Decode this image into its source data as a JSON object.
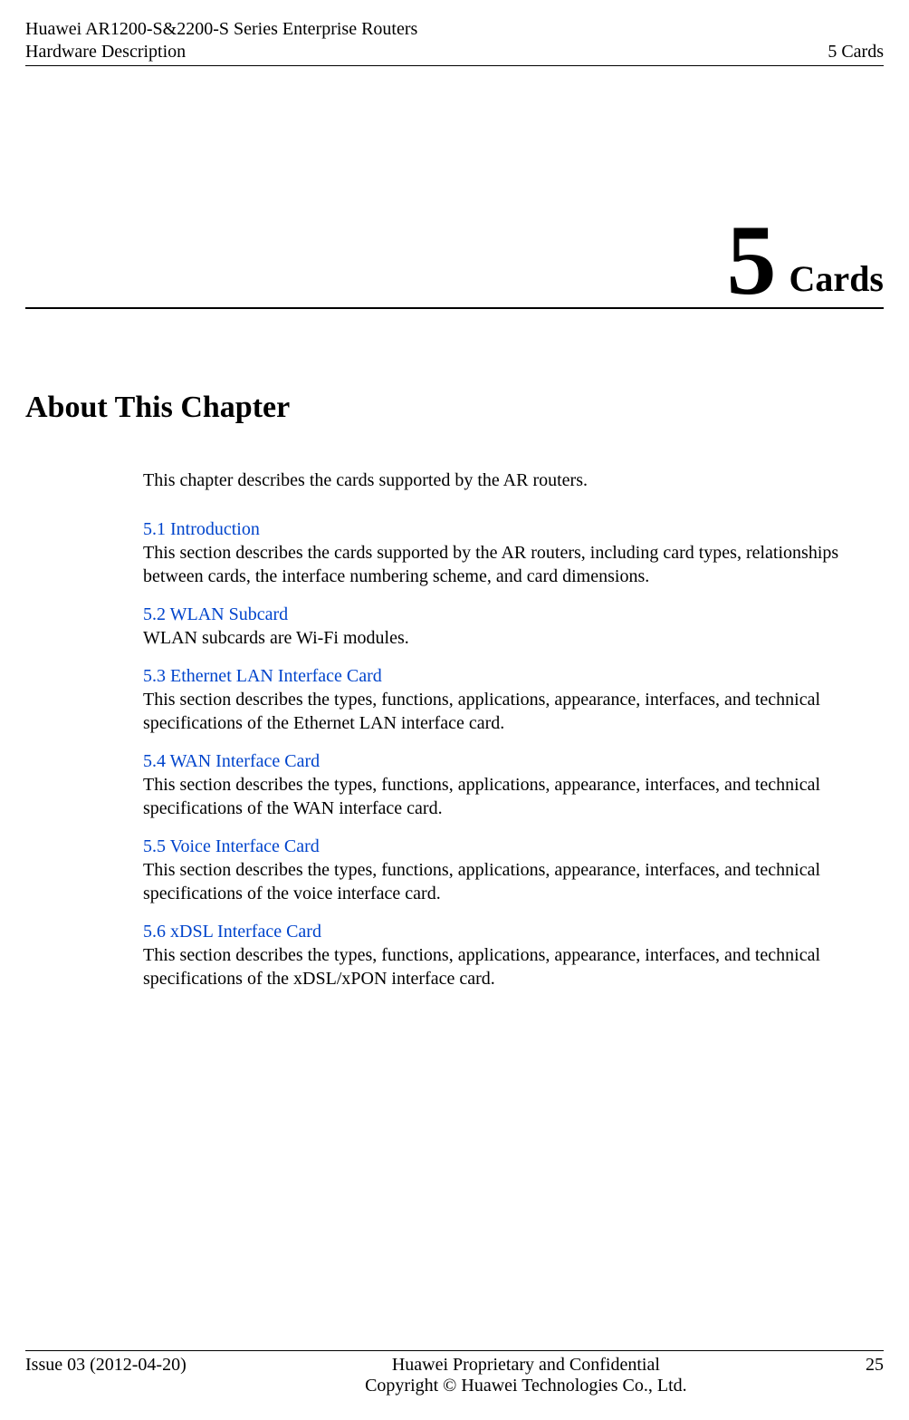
{
  "header": {
    "left_line1": "Huawei AR1200-S&2200-S Series Enterprise Routers",
    "left_line2": "Hardware Description",
    "right": "5 Cards"
  },
  "chapter": {
    "number": "5",
    "name": "Cards"
  },
  "about_heading": "About This Chapter",
  "intro": "This chapter describes the cards supported by the AR routers.",
  "sections": [
    {
      "link": "5.1 Introduction",
      "desc": "This section describes the cards supported by the AR routers, including card types, relationships between cards, the interface numbering scheme, and card dimensions."
    },
    {
      "link": "5.2 WLAN Subcard",
      "desc": "WLAN subcards are Wi-Fi modules."
    },
    {
      "link": "5.3 Ethernet LAN Interface Card",
      "desc": "This section describes the types, functions, applications, appearance, interfaces, and technical specifications of the Ethernet LAN interface card."
    },
    {
      "link": "5.4 WAN Interface Card",
      "desc": "This section describes the types, functions, applications, appearance, interfaces, and technical specifications of the WAN interface card."
    },
    {
      "link": "5.5 Voice Interface Card",
      "desc": "This section describes the types, functions, applications, appearance, interfaces, and technical specifications of the voice interface card."
    },
    {
      "link": "5.6 xDSL Interface Card",
      "desc": "This section describes the types, functions, applications, appearance, interfaces, and technical specifications of the xDSL/xPON interface card."
    }
  ],
  "footer": {
    "left": "Issue 03 (2012-04-20)",
    "center_line1": "Huawei Proprietary and Confidential",
    "center_line2": "Copyright © Huawei Technologies Co., Ltd.",
    "right": "25"
  }
}
